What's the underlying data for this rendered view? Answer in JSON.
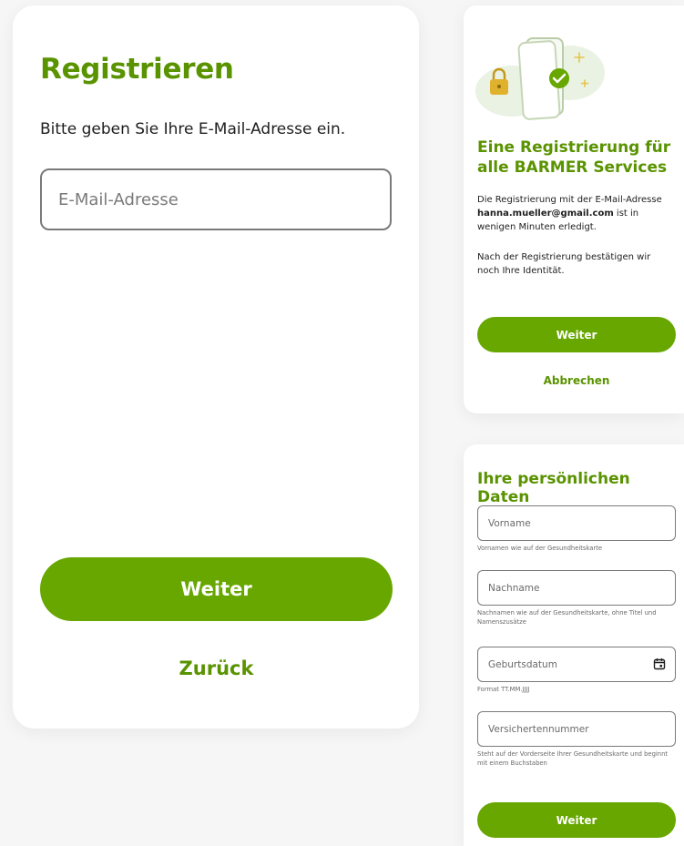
{
  "main": {
    "title": "Registrieren",
    "subtitle": "Bitte geben Sie Ihre E-Mail-Adresse ein.",
    "email_placeholder": "E-Mail-Adresse",
    "email_value": "",
    "primary_label": "Weiter",
    "back_label": "Zurück"
  },
  "info": {
    "title": "Eine Registrierung für alle BARMER Services",
    "p1_before": "Die Registrierung mit der E-Mail-Adresse ",
    "p1_email": "hanna.mueller@gmail.com",
    "p1_after": " ist in wenigen Minuten erledigt.",
    "p2": "Nach der Registrierung bestätigen wir noch Ihre Identität.",
    "primary_label": "Weiter",
    "cancel_label": "Abbrechen",
    "illustration_icons": [
      "phone-icon",
      "lock-icon",
      "check-icon",
      "sparkle-icon"
    ]
  },
  "personal": {
    "title": "Ihre persönlichen Daten",
    "fields": [
      {
        "placeholder": "Vorname",
        "value": "",
        "hint": "Vornamen wie auf der Gesundheitskarte"
      },
      {
        "placeholder": "Nachname",
        "value": "",
        "hint": "Nachnamen wie auf der Gesundheitskarte, ohne Titel und Namenszusätze"
      },
      {
        "placeholder": "Geburtsdatum",
        "value": "",
        "hint": "Format TT.MM.JJJJ",
        "icon": "calendar-icon"
      },
      {
        "placeholder": "Versichertennummer",
        "value": "",
        "hint": "Steht auf der Vorderseite Ihrer Gesundheitskarte und beginnt mit einem Buchstaben"
      }
    ],
    "primary_label": "Weiter"
  },
  "colors": {
    "brand_green": "#67a700",
    "heading_green": "#5a9300",
    "background": "#f6f6f6",
    "card": "#ffffff",
    "border": "#7a7a7a"
  }
}
